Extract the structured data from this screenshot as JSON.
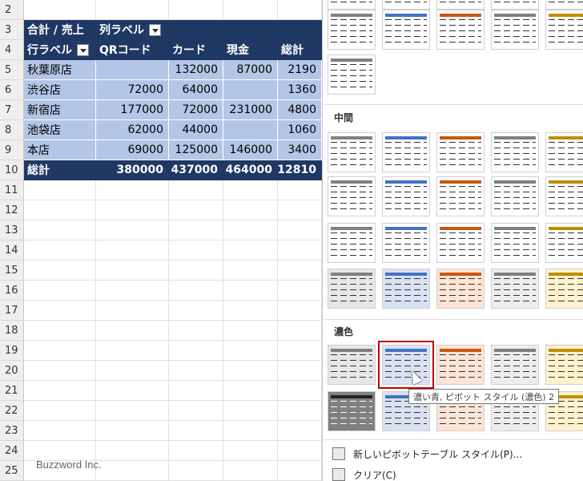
{
  "sheet": {
    "row_numbers": [
      "2",
      "3",
      "4",
      "5",
      "6",
      "7",
      "8",
      "9",
      "10",
      "11",
      "12",
      "13",
      "14",
      "15",
      "16",
      "17",
      "18",
      "19",
      "20",
      "21",
      "22",
      "23",
      "24",
      "25"
    ],
    "header1": {
      "label": "合計 / 売上",
      "col_label": "列ラベル"
    },
    "header2": {
      "row_label": "行ラベル",
      "cols": [
        "QRコード",
        "カード",
        "現金",
        "総計"
      ]
    },
    "rows": [
      {
        "name": "秋葉原店",
        "values": [
          "",
          "132000",
          "87000",
          "2190"
        ]
      },
      {
        "name": "渋谷店",
        "values": [
          "72000",
          "64000",
          "",
          "1360"
        ]
      },
      {
        "name": "新宿店",
        "values": [
          "177000",
          "72000",
          "231000",
          "4800"
        ]
      },
      {
        "name": "池袋店",
        "values": [
          "62000",
          "44000",
          "",
          "1060"
        ]
      },
      {
        "name": "本店",
        "values": [
          "69000",
          "125000",
          "146000",
          "3400"
        ]
      }
    ],
    "total": {
      "label": "総計",
      "values": [
        "380000",
        "437000",
        "464000",
        "12810"
      ]
    },
    "watermark": "Buzzword Inc."
  },
  "panel": {
    "section_medium": "中間",
    "section_dark": "濃色",
    "tooltip": "濃い青, ピボット スタイル (濃色) 2",
    "menu_new": "新しいピボットテーブル スタイル(P)...",
    "menu_clear": "クリア(C)",
    "colors": {
      "dark_blue": "#203864",
      "light_blue": "#b4c6e7",
      "selection": "#c00000"
    }
  }
}
